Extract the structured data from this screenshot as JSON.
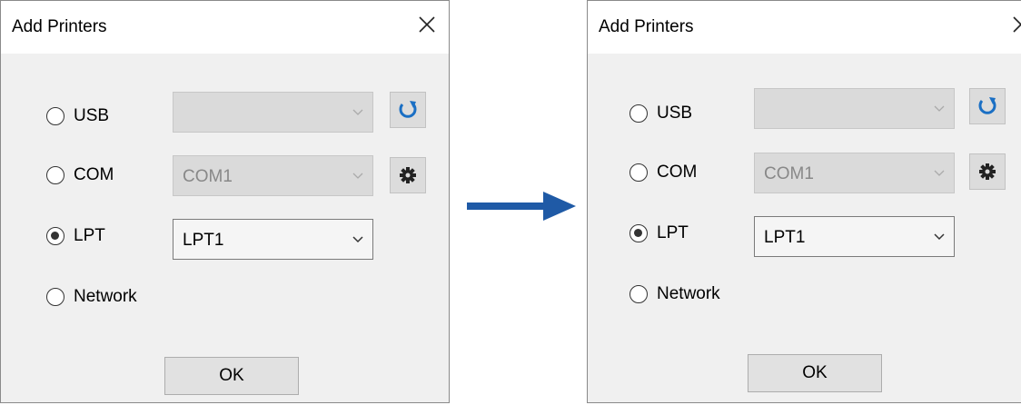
{
  "dialog_before": {
    "title": "Add Printers",
    "options": [
      {
        "label": "USB",
        "selected": false
      },
      {
        "label": "COM",
        "selected": false
      },
      {
        "label": "LPT",
        "selected": true
      },
      {
        "label": "Network",
        "selected": false
      }
    ],
    "usb_port": "",
    "com_port": "COM1",
    "lpt_port": "LPT1",
    "ok_label": "OK"
  },
  "dialog_after": {
    "title": "Add Printers",
    "options": [
      {
        "label": "USB",
        "selected": false
      },
      {
        "label": "COM",
        "selected": false
      },
      {
        "label": "LPT",
        "selected": true
      },
      {
        "label": "Network",
        "selected": false
      }
    ],
    "usb_port": "",
    "com_port": "COM1",
    "lpt_port": "LPT1",
    "ok_label": "OK"
  },
  "colors": {
    "arrow": "#1f5aa6",
    "refresh_icon": "#1a6fc4",
    "gear_icon": "#222222"
  },
  "icons": [
    "close-icon",
    "refresh-icon",
    "gear-icon",
    "chevron-down-icon",
    "right-arrow-icon"
  ]
}
